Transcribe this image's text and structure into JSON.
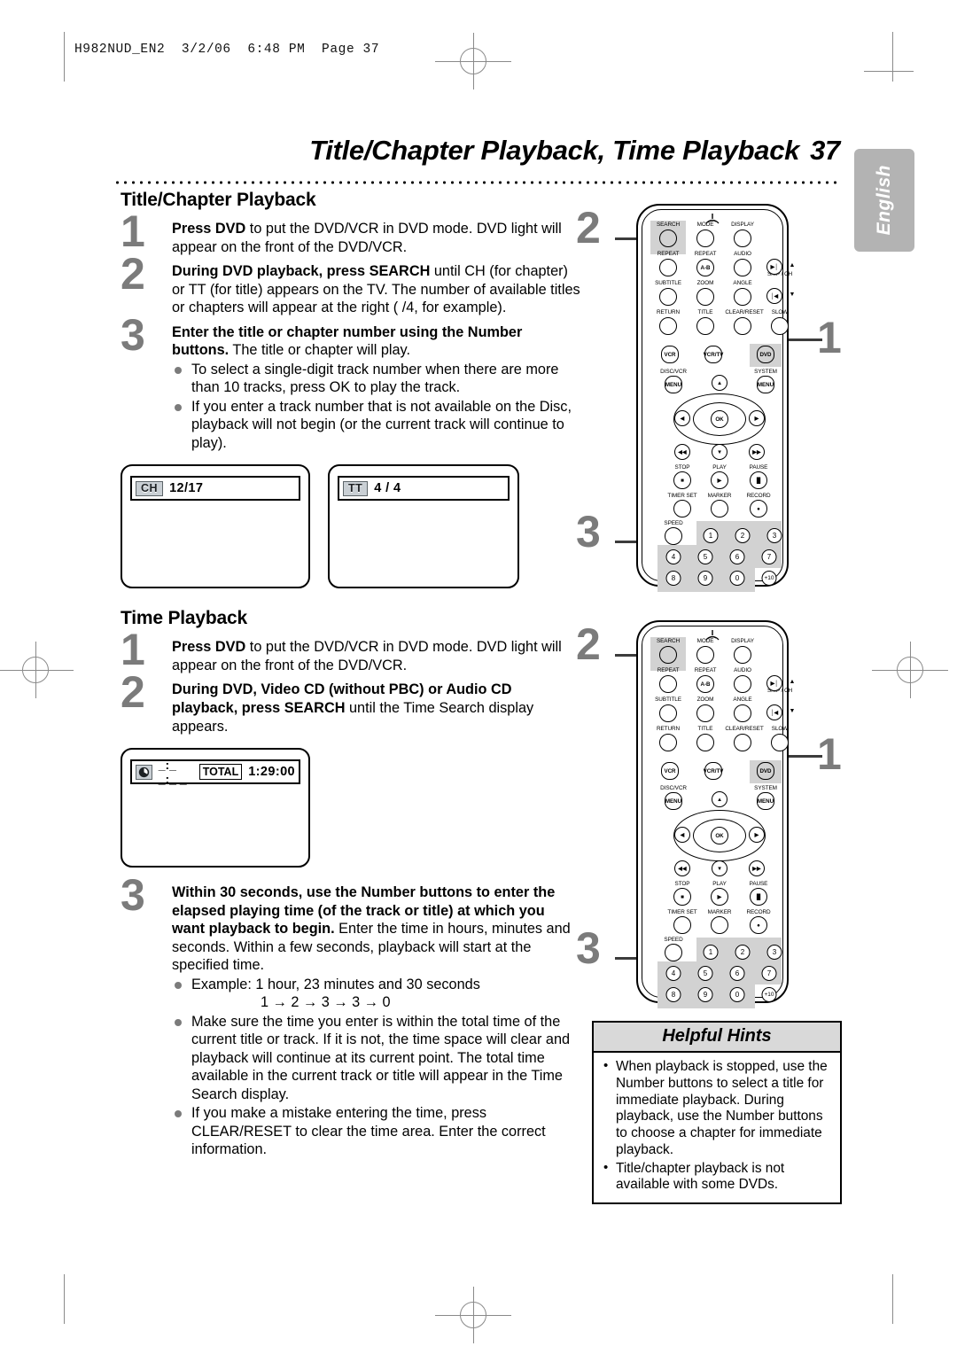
{
  "printmark": {
    "filestamp": "H982NUD_EN2  3/2/06  6:48 PM  Page 37"
  },
  "header": {
    "title": "Title/Chapter Playback, Time Playback",
    "page_number": "37",
    "language_tab": "English"
  },
  "sections": [
    {
      "heading": "Title/Chapter Playback",
      "steps": [
        {
          "number": "1",
          "bold": "Press DVD",
          "rest": " to put the DVD/VCR in DVD mode. DVD light will appear on the front of the DVD/VCR."
        },
        {
          "number": "2",
          "bold": "During DVD playback, press SEARCH",
          "rest": " until CH (for chapter) or TT (for title) appears on the TV. The number of available titles or chapters will appear at the right (  /4, for example)."
        },
        {
          "number": "3",
          "bold": "Enter the title or chapter number using the Number buttons.",
          "rest": " The title or chapter will play.",
          "bullets": [
            "To select a single-digit track number when there are more than 10 tracks, press OK to play the track.",
            "If you enter a track number that is not available on the Disc, playback will not begin (or the current track will continue to play)."
          ]
        }
      ]
    },
    {
      "heading": "Time Playback",
      "steps": [
        {
          "number": "1",
          "bold": "Press DVD",
          "rest": " to put the DVD/VCR in DVD mode. DVD light will appear on the front of the DVD/VCR."
        },
        {
          "number": "2",
          "bold": "During DVD, Video CD (without PBC) or Audio CD playback, press SEARCH",
          "rest": " until the Time Search display appears."
        },
        {
          "number": "3",
          "bold": "Within 30 seconds, use the Number buttons to enter the elapsed playing time (of the track or title) at which you want playback to begin.",
          "rest": " Enter the time in hours, minutes and seconds. Within a few seconds, playback will start at the specified time.",
          "bullets": [
            "Example: 1 hour, 23 minutes and 30 seconds",
            "Make sure the time you enter is within the total time of the current title or track. If it is not, the time space will clear and playback will continue at its current point. The total time available in the current track or title will appear in the Time Search display.",
            "If you make a mistake entering the time, press CLEAR/RESET to clear the time area. Enter the correct information."
          ],
          "example_sequence": "1 → 2 → 3 → 3 → 0"
        }
      ]
    }
  ],
  "osd_screens": {
    "chapter": {
      "tag": "CH",
      "value": "12/17"
    },
    "title": {
      "tag": "TT",
      "value": "4 / 4"
    },
    "time_search": {
      "icon": "clock-icon",
      "entry": "_:_ _:_ _",
      "total_label": "TOTAL",
      "total_value": "1:29:00"
    }
  },
  "hints": {
    "title": "Helpful Hints",
    "items": [
      "When playback is stopped, use the Number buttons to select a title for immediate playback. During playback, use the Number buttons to choose a chapter for immediate playback.",
      "Title/chapter playback is not available with some DVDs."
    ]
  },
  "remote": {
    "callouts": {
      "top": "2",
      "right": "1",
      "bottom": "3"
    },
    "rows": [
      {
        "labels": [
          "SEARCH",
          "MODE",
          "DISPLAY"
        ],
        "buttons": [
          "",
          "",
          ""
        ]
      },
      {
        "labels": [
          "REPEAT",
          "REPEAT",
          "AUDIO",
          "SKIP / CH"
        ],
        "buttons": [
          "",
          "A-B",
          "",
          "▶|"
        ]
      },
      {
        "labels": [
          "SUBTITLE",
          "ZOOM",
          "ANGLE"
        ],
        "buttons": [
          "",
          "",
          "",
          "|◀"
        ]
      },
      {
        "labels": [
          "RETURN",
          "TITLE",
          "CLEAR/RESET",
          "SLOW"
        ],
        "buttons": [
          "",
          "",
          "",
          ""
        ]
      }
    ],
    "mode_buttons": [
      "VCR",
      "VCR/TV",
      "DVD"
    ],
    "menu_labels": [
      "DISC/VCR",
      "SYSTEM"
    ],
    "menu_buttons": [
      "MENU",
      "MENU"
    ],
    "ok_button": "OK",
    "transport_labels": [
      "STOP",
      "PLAY",
      "PAUSE"
    ],
    "function_labels": [
      "TIMER SET",
      "MARKER",
      "RECORD"
    ],
    "speed_label": "SPEED",
    "keypad": [
      "1",
      "2",
      "3",
      "4",
      "5",
      "6",
      "7",
      "8",
      "9",
      "0",
      "+10"
    ]
  },
  "colors": {
    "step_number": "#7b7b7b",
    "lang_tab": "#b3b3b3",
    "hint_header": "#d9d9d9",
    "highlight": "#d2d2d2",
    "osd_tag": "#c9cfd4"
  }
}
